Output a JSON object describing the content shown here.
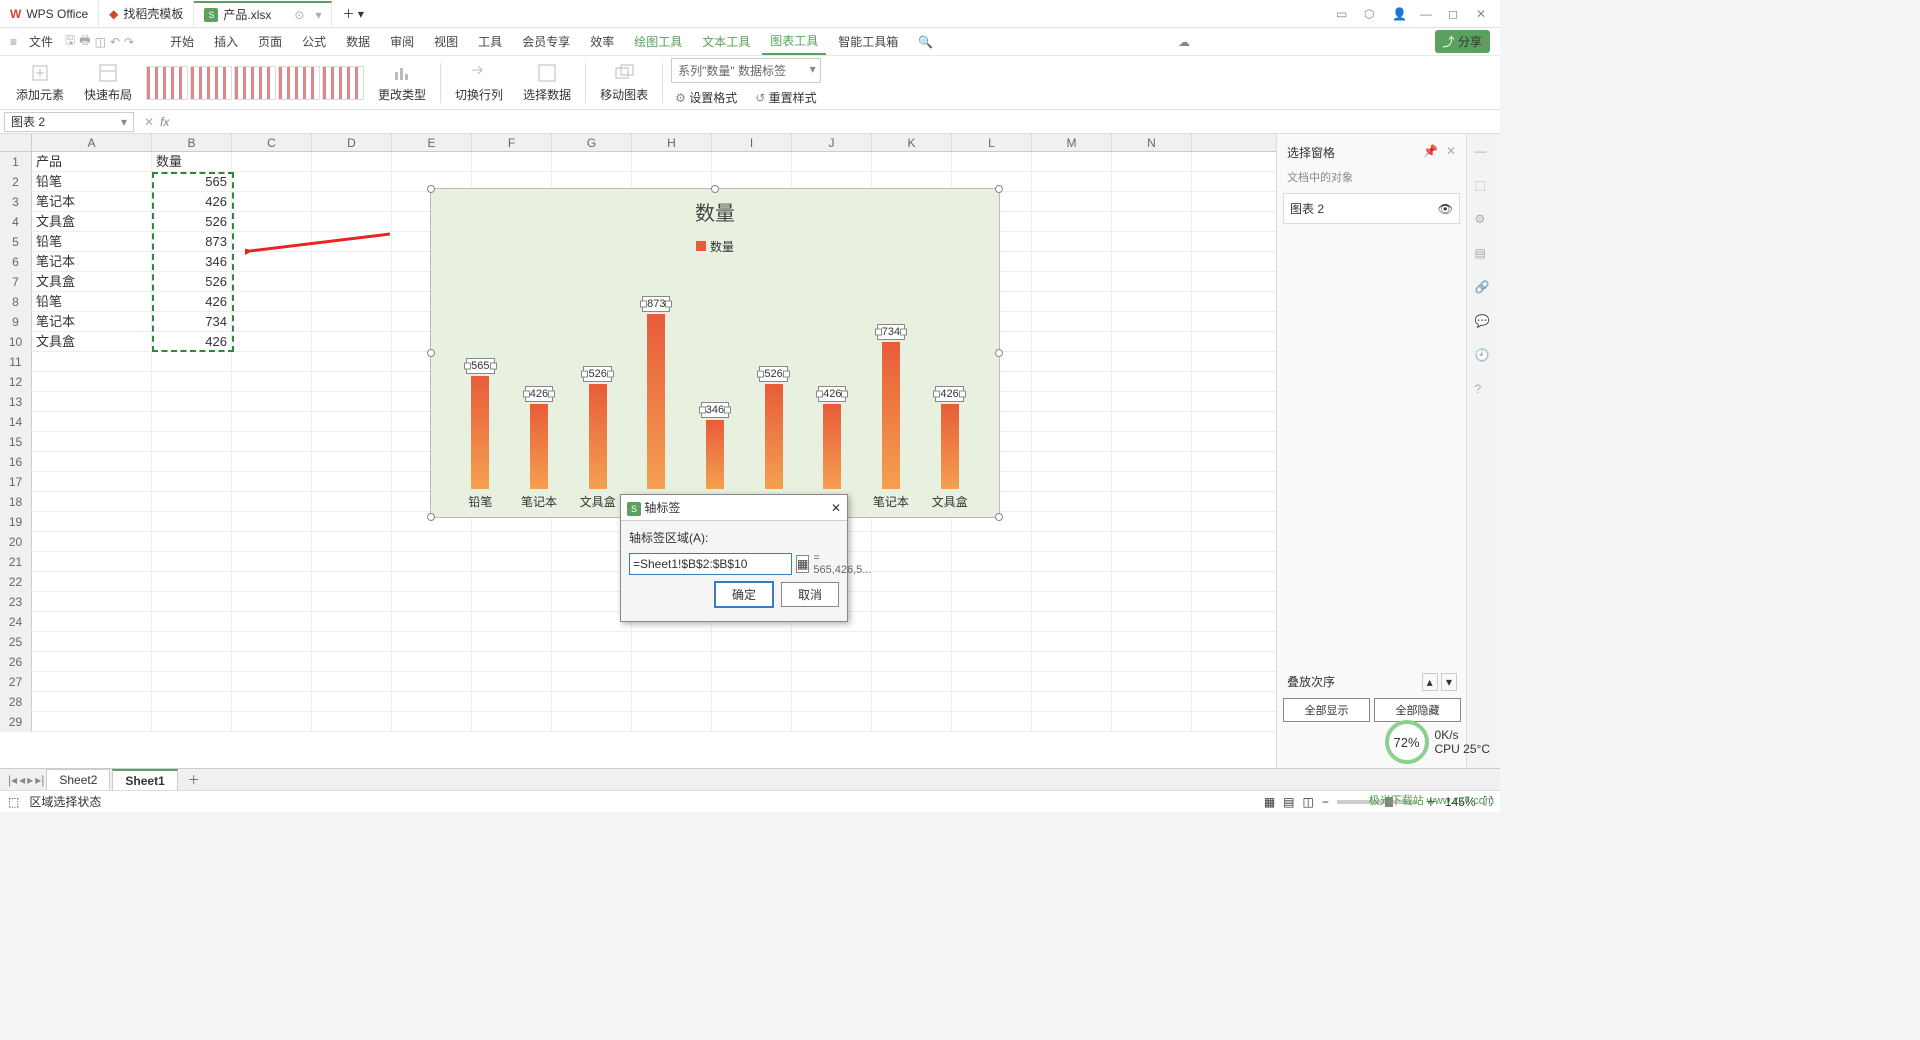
{
  "title_tabs": [
    "WPS Office",
    "找稻壳模板",
    "产品.xlsx"
  ],
  "menubar": {
    "file": "文件",
    "items": [
      "开始",
      "插入",
      "页面",
      "公式",
      "数据",
      "审阅",
      "视图",
      "工具",
      "会员专享",
      "效率",
      "绘图工具",
      "文本工具",
      "图表工具",
      "智能工具箱"
    ],
    "share": "分享"
  },
  "ribbon": {
    "add_element": "添加元素",
    "quick_layout": "快速布局",
    "change_type": "更改类型",
    "switch_rowcol": "切换行列",
    "select_data": "选择数据",
    "move_chart": "移动图表",
    "series_dropdown": "系列\"数量\" 数据标签",
    "set_format": "设置格式",
    "reset_style": "重置样式"
  },
  "name_box": "图表 2",
  "fx_label": "fx",
  "columns": [
    "A",
    "B",
    "C",
    "D",
    "E",
    "F",
    "G",
    "H",
    "I",
    "J",
    "K",
    "L",
    "M",
    "N"
  ],
  "rows_count": 29,
  "table": {
    "header": [
      "产品",
      "数量"
    ],
    "data": [
      [
        "铅笔",
        565
      ],
      [
        "笔记本",
        426
      ],
      [
        "文具盒",
        526
      ],
      [
        "铅笔",
        873
      ],
      [
        "笔记本",
        346
      ],
      [
        "文具盒",
        526
      ],
      [
        "铅笔",
        426
      ],
      [
        "笔记本",
        734
      ],
      [
        "文具盒",
        426
      ]
    ]
  },
  "chart_data": {
    "type": "bar",
    "title": "数量",
    "legend": "数量",
    "categories": [
      "铅笔",
      "笔记本",
      "文具盒",
      "铅笔",
      "笔记本",
      "文具盒",
      "铅笔",
      "笔记本",
      "文具盒"
    ],
    "values": [
      565,
      426,
      526,
      873,
      346,
      526,
      426,
      734,
      426
    ],
    "ylim": [
      0,
      900
    ]
  },
  "dialog": {
    "title": "轴标签",
    "range_label": "轴标签区域(A):",
    "input_value": "=Sheet1!$B$2:$B$10",
    "preview": "= 565,426,5...",
    "ok": "确定",
    "cancel": "取消"
  },
  "side_panel": {
    "title": "选择窗格",
    "subtitle": "文档中的对象",
    "item": "图表 2",
    "stack_order": "叠放次序",
    "show_all": "全部显示",
    "hide_all": "全部隐藏"
  },
  "sheet_tabs": [
    "Sheet2",
    "Sheet1"
  ],
  "statusbar": {
    "mode": "区域选择状态",
    "zoom": "145%"
  },
  "perf": {
    "pct": "72%",
    "net": "0K/s",
    "cpu": "CPU 25°C"
  },
  "watermark": "极光下载站 www.xz7.com"
}
